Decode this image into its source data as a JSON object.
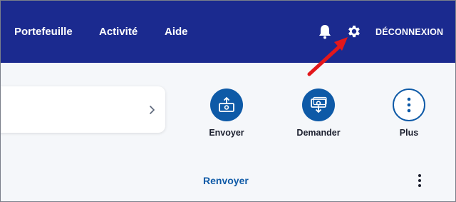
{
  "nav": {
    "links": [
      {
        "label": "Portefeuille"
      },
      {
        "label": "Activité"
      },
      {
        "label": "Aide"
      }
    ],
    "logout_label": "DÉCONNEXION",
    "icons": {
      "notifications": "bell-icon",
      "settings": "gear-icon"
    }
  },
  "actions": [
    {
      "label": "Envoyer",
      "icon": "send-money-icon"
    },
    {
      "label": "Demander",
      "icon": "request-money-icon"
    },
    {
      "label": "Plus",
      "icon": "more-vertical-icon"
    }
  ],
  "activity": {
    "renvoyer_label": "Renvoyer",
    "menu_icon": "kebab-menu-icon"
  },
  "colors": {
    "header": "#1b2a8f",
    "accent": "#0e5aa7",
    "annotation_arrow": "#e3171b",
    "background": "#f5f7fa"
  }
}
